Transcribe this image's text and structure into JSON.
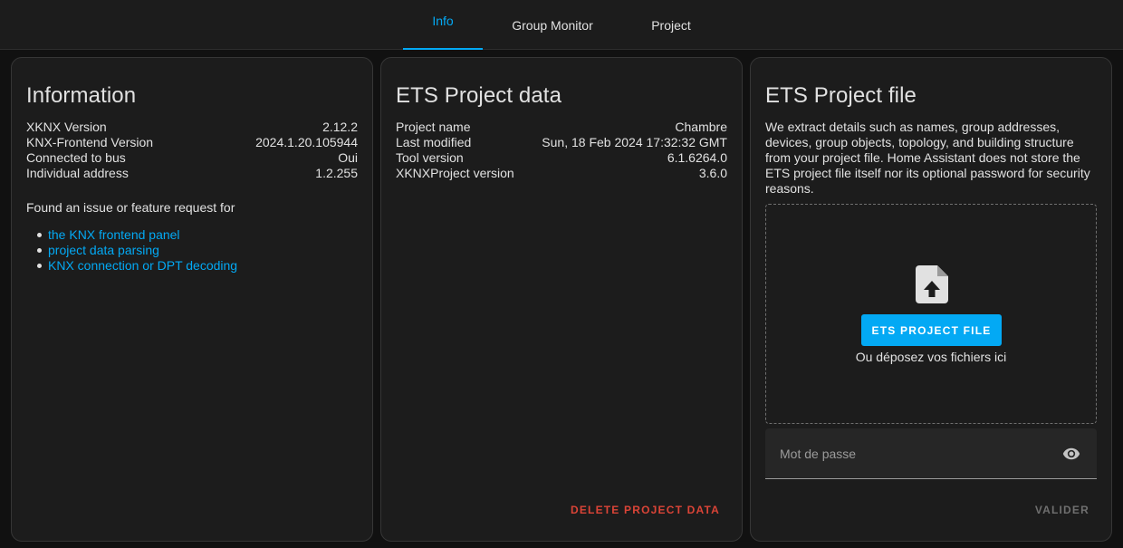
{
  "tabs": [
    {
      "label": "Info"
    },
    {
      "label": "Group Monitor"
    },
    {
      "label": "Project"
    }
  ],
  "information": {
    "title": "Information",
    "rows": [
      {
        "key": "XKNX Version",
        "value": "2.12.2"
      },
      {
        "key": "KNX-Frontend Version",
        "value": "2024.1.20.105944"
      },
      {
        "key": "Connected to bus",
        "value": "Oui"
      },
      {
        "key": "Individual address",
        "value": "1.2.255"
      }
    ],
    "issue_text": "Found an issue or feature request for",
    "links": [
      {
        "label": "the KNX frontend panel"
      },
      {
        "label": "project data parsing"
      },
      {
        "label": "KNX connection or DPT decoding"
      }
    ]
  },
  "project_data": {
    "title": "ETS Project data",
    "rows": [
      {
        "key": "Project name",
        "value": "Chambre"
      },
      {
        "key": "Last modified",
        "value": "Sun, 18 Feb 2024 17:32:32 GMT"
      },
      {
        "key": "Tool version",
        "value": "6.1.6264.0"
      },
      {
        "key": "XKNXProject version",
        "value": "3.6.0"
      }
    ],
    "delete_label": "DELETE PROJECT DATA"
  },
  "project_file": {
    "title": "ETS Project file",
    "description": "We extract details such as names, group addresses, devices, group objects, topology, and building structure from your project file. Home Assistant does not store the ETS project file itself nor its optional password for security reasons.",
    "upload_label": "ETS PROJECT FILE",
    "drop_text": "Ou déposez vos fichiers ici",
    "file_icon": "file-upload-icon",
    "password_placeholder": "Mot de passe",
    "password_value": "",
    "eye_icon": "eye-icon",
    "validate_label": "VALIDER"
  },
  "colors": {
    "accent": "#03a9f4",
    "danger": "#db4437",
    "card_bg": "#1c1c1c",
    "page_bg": "#111111"
  }
}
